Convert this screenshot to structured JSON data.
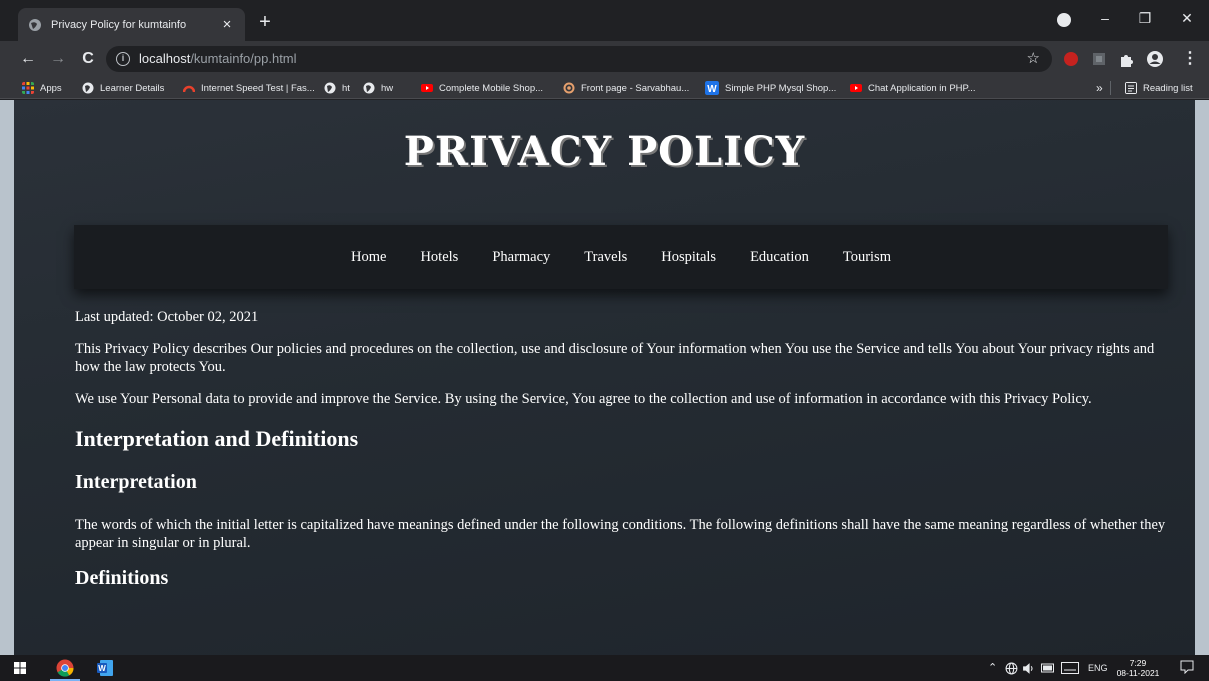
{
  "browser": {
    "tab_title": "Privacy Policy for kumtainfo",
    "tab_close": "×",
    "new_tab": "+",
    "url_host": "localhost",
    "url_path": "/kumtainfo/pp.html",
    "window_controls": {
      "minimize": "–",
      "restore": "❐",
      "close": "✕"
    },
    "nav": {
      "back": "←",
      "forward": "→",
      "reload": "C",
      "star": "☆",
      "menu": "⋮"
    },
    "bookmarks": [
      {
        "label": "Apps",
        "icon": "apps-grid-icon",
        "color": "#f4b400"
      },
      {
        "label": "Learner Details",
        "icon": "globe-icon",
        "color": "#e8eaed"
      },
      {
        "label": "Internet Speed Test | Fas...",
        "icon": "speedometer-icon",
        "color": "#e8412c"
      },
      {
        "label": "ht",
        "icon": "globe-icon",
        "color": "#e8eaed"
      },
      {
        "label": "hw",
        "icon": "globe-icon",
        "color": "#e8eaed"
      },
      {
        "label": "Complete Mobile Shop...",
        "icon": "youtube-icon",
        "color": "#ff0000"
      },
      {
        "label": "Front page - Sarvabhau...",
        "icon": "target-icon",
        "color": "#e6a06d"
      },
      {
        "label": "Simple PHP Mysql Shop...",
        "icon": "w-logo-icon",
        "color": "#1e73e8"
      },
      {
        "label": "Chat Application in PHP...",
        "icon": "youtube-icon",
        "color": "#ff0000"
      }
    ],
    "bookmarks_overflow": "»",
    "reading_list": "Reading list"
  },
  "page": {
    "site_title": "PRIVACY POLICY",
    "nav_items": [
      "Home",
      "Hotels",
      "Pharmacy",
      "Travels",
      "Hospitals",
      "Education",
      "Tourism"
    ],
    "last_updated": "Last updated: October 02, 2021",
    "intro_1": "This Privacy Policy describes Our policies and procedures on the collection, use and disclosure of Your information when You use the Service and tells You about Your privacy rights and how the law protects You.",
    "intro_2": "We use Your Personal data to provide and improve the Service. By using the Service, You agree to the collection and use of information in accordance with this Privacy Policy.",
    "heading_interp_defs": "Interpretation and Definitions",
    "heading_interp": "Interpretation",
    "interp_text": "The words of which the initial letter is capitalized have meanings defined under the following conditions. The following definitions shall have the same meaning regardless of whether they appear in singular or in plural.",
    "heading_defs": "Definitions"
  },
  "taskbar": {
    "tray_up": "⌃",
    "language": "ENG",
    "time": "7:29",
    "date": "08-11-2021"
  },
  "colors": {
    "page_bg": "#252c33",
    "nav_bg": "#191c20",
    "browser_dark": "#202124",
    "browser_toolbar": "#35363a"
  }
}
